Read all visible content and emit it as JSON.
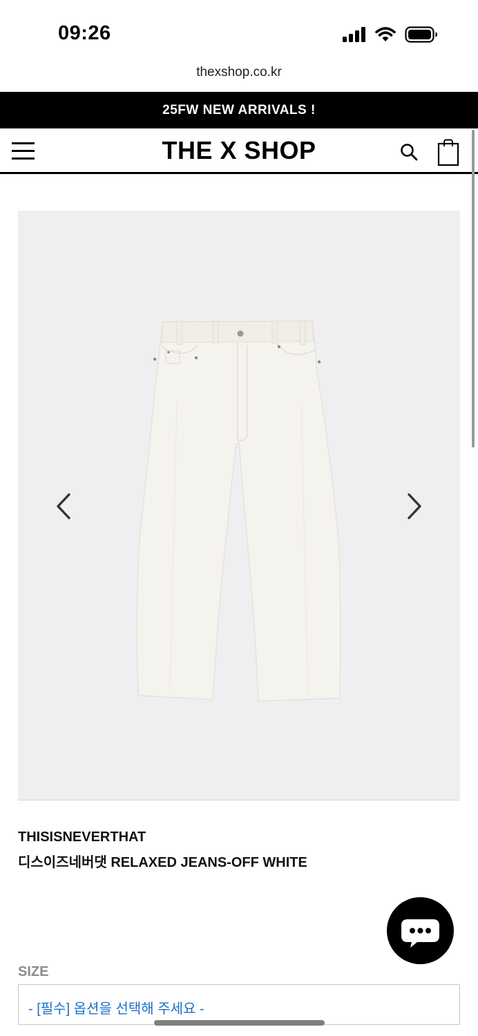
{
  "status_bar": {
    "time": "09:26"
  },
  "browser": {
    "url": "thexshop.co.kr"
  },
  "promo_banner": {
    "text": "25FW NEW ARRIVALS !"
  },
  "header": {
    "logo": "THE X SHOP",
    "icons": [
      "menu-icon",
      "search-icon",
      "shopping-bag-icon"
    ]
  },
  "product": {
    "brand": "THISISNEVERTHAT",
    "name": "디스이즈네버댓 RELAXED JEANS-OFF WHITE",
    "image_subject": "off-white-jeans",
    "colors": {
      "gallery_bg": "#efeff1",
      "jeans": "#f4f2ec"
    }
  },
  "options": {
    "size_label": "SIZE",
    "size_select_value": "- [필수] 옵션을 선택해 주세요 -"
  },
  "colors": {
    "banner_bg": "#000000",
    "select_text": "#1a6fc9",
    "label_gray": "#8c8c8c"
  }
}
